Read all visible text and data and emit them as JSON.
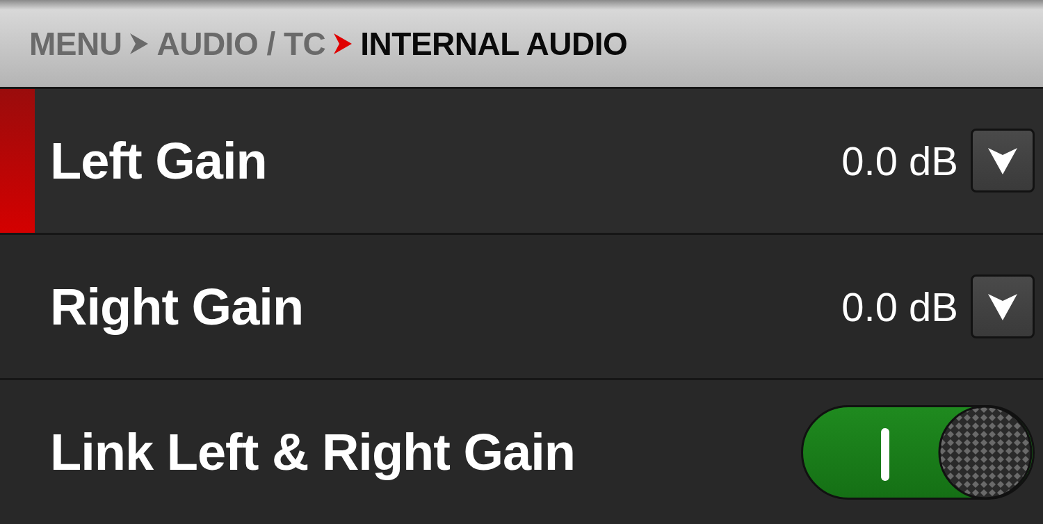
{
  "breadcrumb": [
    {
      "label": "MENU",
      "current": false
    },
    {
      "label": "AUDIO / TC",
      "current": false
    },
    {
      "label": "INTERNAL AUDIO",
      "current": true
    }
  ],
  "rows": [
    {
      "kind": "dropdown",
      "label": "Left Gain",
      "value": "0.0 dB",
      "selected": true
    },
    {
      "kind": "dropdown",
      "label": "Right Gain",
      "value": "0.0 dB",
      "selected": false
    },
    {
      "kind": "toggle",
      "label": "Link Left & Right Gain",
      "on": true,
      "selected": false
    }
  ]
}
